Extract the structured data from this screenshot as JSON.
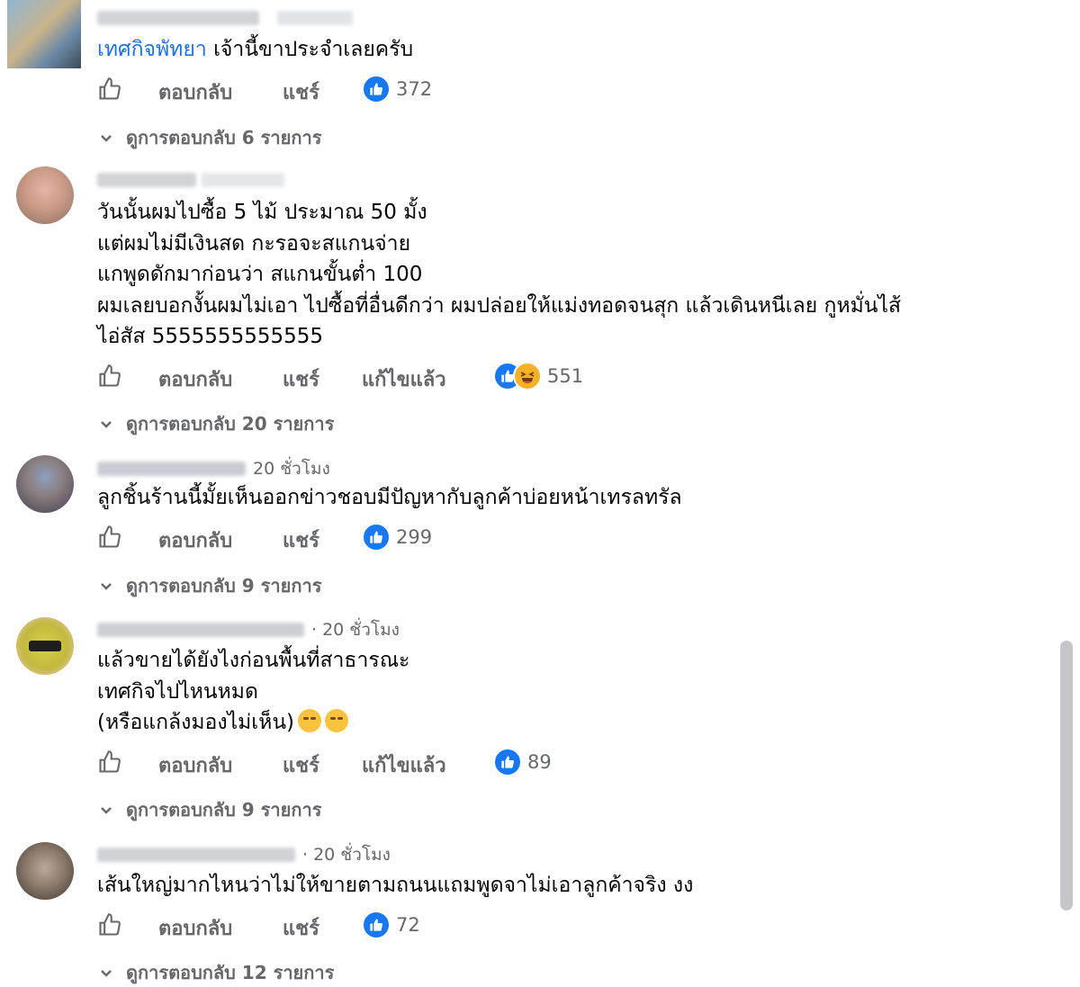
{
  "comments": [
    {
      "lines": [
        "เจ้านี้ขาประจำเลยครับ"
      ],
      "page_tag": "เทศกิจพัทยา",
      "time": "",
      "actions": [
        "ตอบกลับ",
        "แชร์"
      ],
      "reaction_count": "372",
      "reactions": [
        "like"
      ],
      "replies": "ดูการตอบกลับ 6 รายการ"
    },
    {
      "lines": [
        "วันนั้นผมไปซื้อ 5 ไม้ ประมาณ 50 มั้ง",
        "แต่ผมไม่มีเงินสด กะรอจะสแกนจ่าย",
        "แกพูดดักมาก่อนว่า สแกนขั้นต่ำ 100",
        "ผมเลยบอกงั้นผมไม่เอา ไปซื้อที่อื่นดีกว่า ผมปล่อยให้แม่งทอดจนสุก แล้วเดินหนีเลย กูหมั่นไส้",
        "ไอ่สัส 5555555555555"
      ],
      "time": "",
      "actions": [
        "ตอบกลับ",
        "แชร์",
        "แก้ไขแล้ว"
      ],
      "reaction_count": "551",
      "reactions": [
        "like",
        "haha"
      ],
      "replies": "ดูการตอบกลับ 20 รายการ"
    },
    {
      "lines": [
        "ลูกชิ้นร้านนี้มั้ยเห็นออกข่าวชอบมีปัญหากับลูกค้าบ่อยหน้าเทรลทรัล"
      ],
      "time": "20 ชั่วโมง",
      "actions": [
        "ตอบกลับ",
        "แชร์"
      ],
      "reaction_count": "299",
      "reactions": [
        "like"
      ],
      "replies": "ดูการตอบกลับ 9 รายการ"
    },
    {
      "lines": [
        "แล้วขายได้ยังไงก่อนพื้นที่สาธารณะ",
        "เทศกิจไปไหนหมด",
        "(หรือแกล้งมองไม่เห็น)"
      ],
      "time": "· 20 ชั่วโมง",
      "actions": [
        "ตอบกลับ",
        "แชร์",
        "แก้ไขแล้ว"
      ],
      "reaction_count": "89",
      "reactions": [
        "like"
      ],
      "replies": "ดูการตอบกลับ 9 รายการ"
    },
    {
      "lines": [
        "เส้นใหญ่มากไหนว่าไม่ให้ขายตามถนนแถมพูดจาไม่เอาลูกค้าจริง งง"
      ],
      "time": "· 20 ชั่วโมง",
      "actions": [
        "ตอบกลับ",
        "แชร์"
      ],
      "reaction_count": "72",
      "reactions": [
        "like"
      ],
      "replies": "ดูการตอบกลับ 12 รายการ"
    }
  ],
  "colors": {
    "link": "#216fdb",
    "like": "#1877f2",
    "muted": "#65676b"
  }
}
